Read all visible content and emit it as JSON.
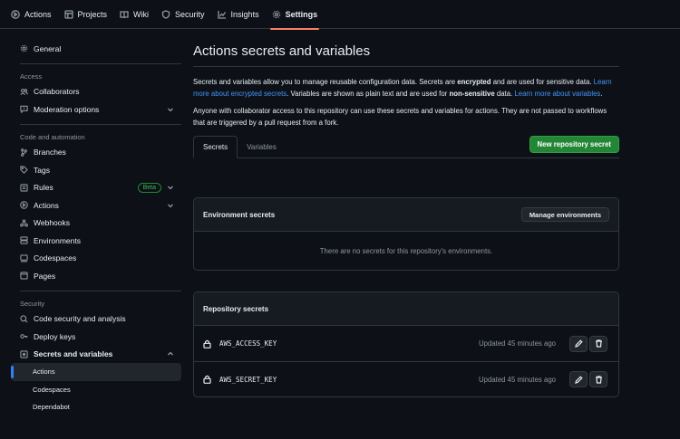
{
  "topnav": {
    "items": [
      {
        "label": "Actions",
        "icon": "play-icon"
      },
      {
        "label": "Projects",
        "icon": "table-icon"
      },
      {
        "label": "Wiki",
        "icon": "book-icon"
      },
      {
        "label": "Security",
        "icon": "shield-icon"
      },
      {
        "label": "Insights",
        "icon": "graph-icon"
      },
      {
        "label": "Settings",
        "icon": "gear-icon"
      }
    ],
    "active": "Settings",
    "accent_color": "#f78166"
  },
  "sidebar": {
    "general": "General",
    "access_heading": "Access",
    "collaborators": "Collaborators",
    "moderation": "Moderation options",
    "code_heading": "Code and automation",
    "branches": "Branches",
    "tags": "Tags",
    "rules": "Rules",
    "beta": "Beta",
    "actions": "Actions",
    "webhooks": "Webhooks",
    "environments": "Environments",
    "codespaces": "Codespaces",
    "pages": "Pages",
    "security_heading": "Security",
    "code_security": "Code security and analysis",
    "deploy_keys": "Deploy keys",
    "secrets_vars": "Secrets and variables",
    "sub_actions": "Actions",
    "sub_codespaces": "Codespaces",
    "sub_dependabot": "Dependabot"
  },
  "main": {
    "title": "Actions secrets and variables",
    "intro": {
      "p1_a": "Secrets and variables allow you to manage reusable configuration data. Secrets are ",
      "p1_b": "encrypted",
      "p1_c": " and are used for sensitive data. ",
      "p1_link1": "Learn more about encrypted secrets",
      "p1_d": ". Variables are shown as plain text and are used for ",
      "p1_e": "non-sensitive",
      "p1_f": " data. ",
      "p1_link2": "Learn more about variables",
      "p1_g": ".",
      "p2": "Anyone with collaborator access to this repository can use these secrets and variables for actions. They are not passed to workflows that are triggered by a pull request from a fork."
    },
    "tabs": [
      "Secrets",
      "Variables"
    ],
    "new_secret_button": "New repository secret",
    "env_box": {
      "title": "Environment secrets",
      "manage_button": "Manage environments",
      "empty_text": "There are no secrets for this repository's environments."
    },
    "repo_box": {
      "title": "Repository secrets",
      "secrets": [
        {
          "name": "AWS_ACCESS_KEY",
          "updated": "Updated 45 minutes ago"
        },
        {
          "name": "AWS_SECRET_KEY",
          "updated": "Updated 45 minutes ago"
        }
      ]
    }
  },
  "colors": {
    "background": "#0d1117",
    "link": "#4493f8",
    "primary_button": "#238636"
  }
}
